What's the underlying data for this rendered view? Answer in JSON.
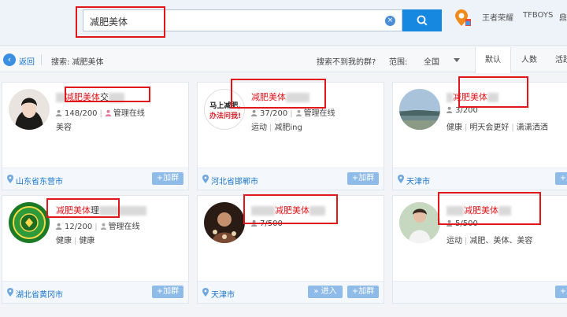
{
  "search": {
    "value": "减肥美体"
  },
  "hot_tags": [
    "王者荣耀",
    "TFBOYS",
    "鼎"
  ],
  "toolbar": {
    "back": "返回",
    "summary": "搜索: 减肥美体",
    "not_found": "搜索不到我的群?",
    "range_label": "范围:",
    "range_value": "全国",
    "sort_tabs": [
      "默认",
      "人数",
      "活跃"
    ]
  },
  "card_actions": {
    "join": "+加群",
    "enter": "» 进入"
  },
  "cards": [
    {
      "name_prefix": "",
      "name_hl": "减肥美体",
      "name_suffix": "交",
      "members": "148/200",
      "manager": "管理在线",
      "tags": [
        "美容"
      ],
      "location": "山东省东营市"
    },
    {
      "name_prefix": "",
      "name_hl": "减肥美体",
      "name_suffix": "",
      "members": "37/200",
      "manager": "管理在线",
      "tags": [
        "运动",
        "减肥ing"
      ],
      "location": "河北省邯郸市",
      "avatar_text": [
        "马上减肥,",
        "办法问我!"
      ]
    },
    {
      "name_prefix": "",
      "name_hl": "减肥美体",
      "name_suffix": "",
      "members": "3/200",
      "manager": "",
      "tags": [
        "健康",
        "明天会更好",
        "潇潇洒洒"
      ],
      "location": "天津市"
    },
    {
      "name_prefix": "",
      "name_hl": "减肥美体",
      "name_suffix": "理",
      "members": "12/200",
      "manager": "管理在线",
      "tags": [
        "健康",
        "健康"
      ],
      "location": "湖北省黄冈市"
    },
    {
      "name_prefix": "",
      "name_hl": "减肥美体",
      "name_suffix": "",
      "members": "7/500",
      "manager": "",
      "tags": [],
      "location": "天津市"
    },
    {
      "name_prefix": "",
      "name_hl": "减肥美体",
      "name_suffix": "",
      "members": "5/500",
      "manager": "",
      "tags": [
        "运动",
        "减肥、美体、美容"
      ],
      "location": ""
    }
  ]
}
